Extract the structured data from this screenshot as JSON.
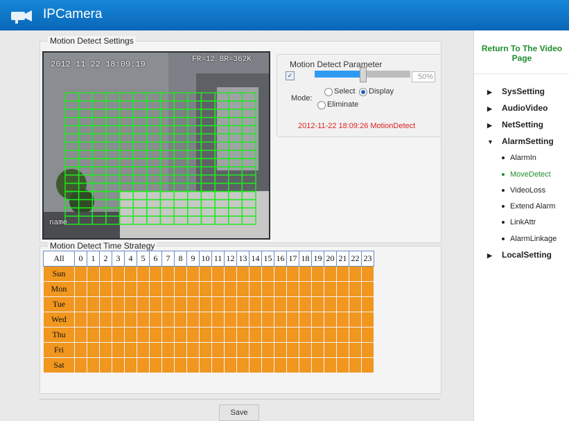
{
  "header": {
    "title": "IPCamera"
  },
  "motion_settings": {
    "section_title": "Motion Detect Settings",
    "video": {
      "timestamp": "2012 11 22 18:09:19",
      "stats": "FR=12 BR=362K",
      "name_overlay": "name"
    },
    "parameter": {
      "title": "Motion Detect Parameter",
      "enabled": true,
      "sensitivity": 50,
      "sensitivity_label": "50%",
      "mode_label": "Mode:",
      "options": [
        "Select",
        "Display",
        "Eliminate"
      ],
      "selected_option": "Display",
      "status": "2012-11-22 18:09:26 MotionDetect"
    }
  },
  "time_strategy": {
    "title": "Motion Detect Time Strategy",
    "all_label": "All",
    "hours": [
      "0",
      "1",
      "2",
      "3",
      "4",
      "5",
      "6",
      "7",
      "8",
      "9",
      "10",
      "11",
      "12",
      "13",
      "14",
      "15",
      "16",
      "17",
      "18",
      "19",
      "20",
      "21",
      "22",
      "23"
    ],
    "days": [
      "Sun",
      "Mon",
      "Tue",
      "Wed",
      "Thu",
      "Fri",
      "Sat"
    ]
  },
  "save_label": "Save",
  "sidebar": {
    "return_link": "Return To The Video Page",
    "items": [
      {
        "label": "SysSetting",
        "expanded": false
      },
      {
        "label": "AudioVideo",
        "expanded": false
      },
      {
        "label": "NetSetting",
        "expanded": false
      },
      {
        "label": "AlarmSetting",
        "expanded": true,
        "children": [
          "AlarmIn",
          "MoveDetect",
          "VideoLoss",
          "Extend Alarm",
          "LinkAttr",
          "AlarmLinkage"
        ]
      },
      {
        "label": "LocalSetting",
        "expanded": false
      }
    ],
    "active_item": "MoveDetect"
  },
  "colors": {
    "header": "#0a72c8",
    "schedule_cell": "#f1961e",
    "grid_line": "#1eea1e",
    "link_green": "#1f8e2d",
    "status_red": "#e02020"
  }
}
